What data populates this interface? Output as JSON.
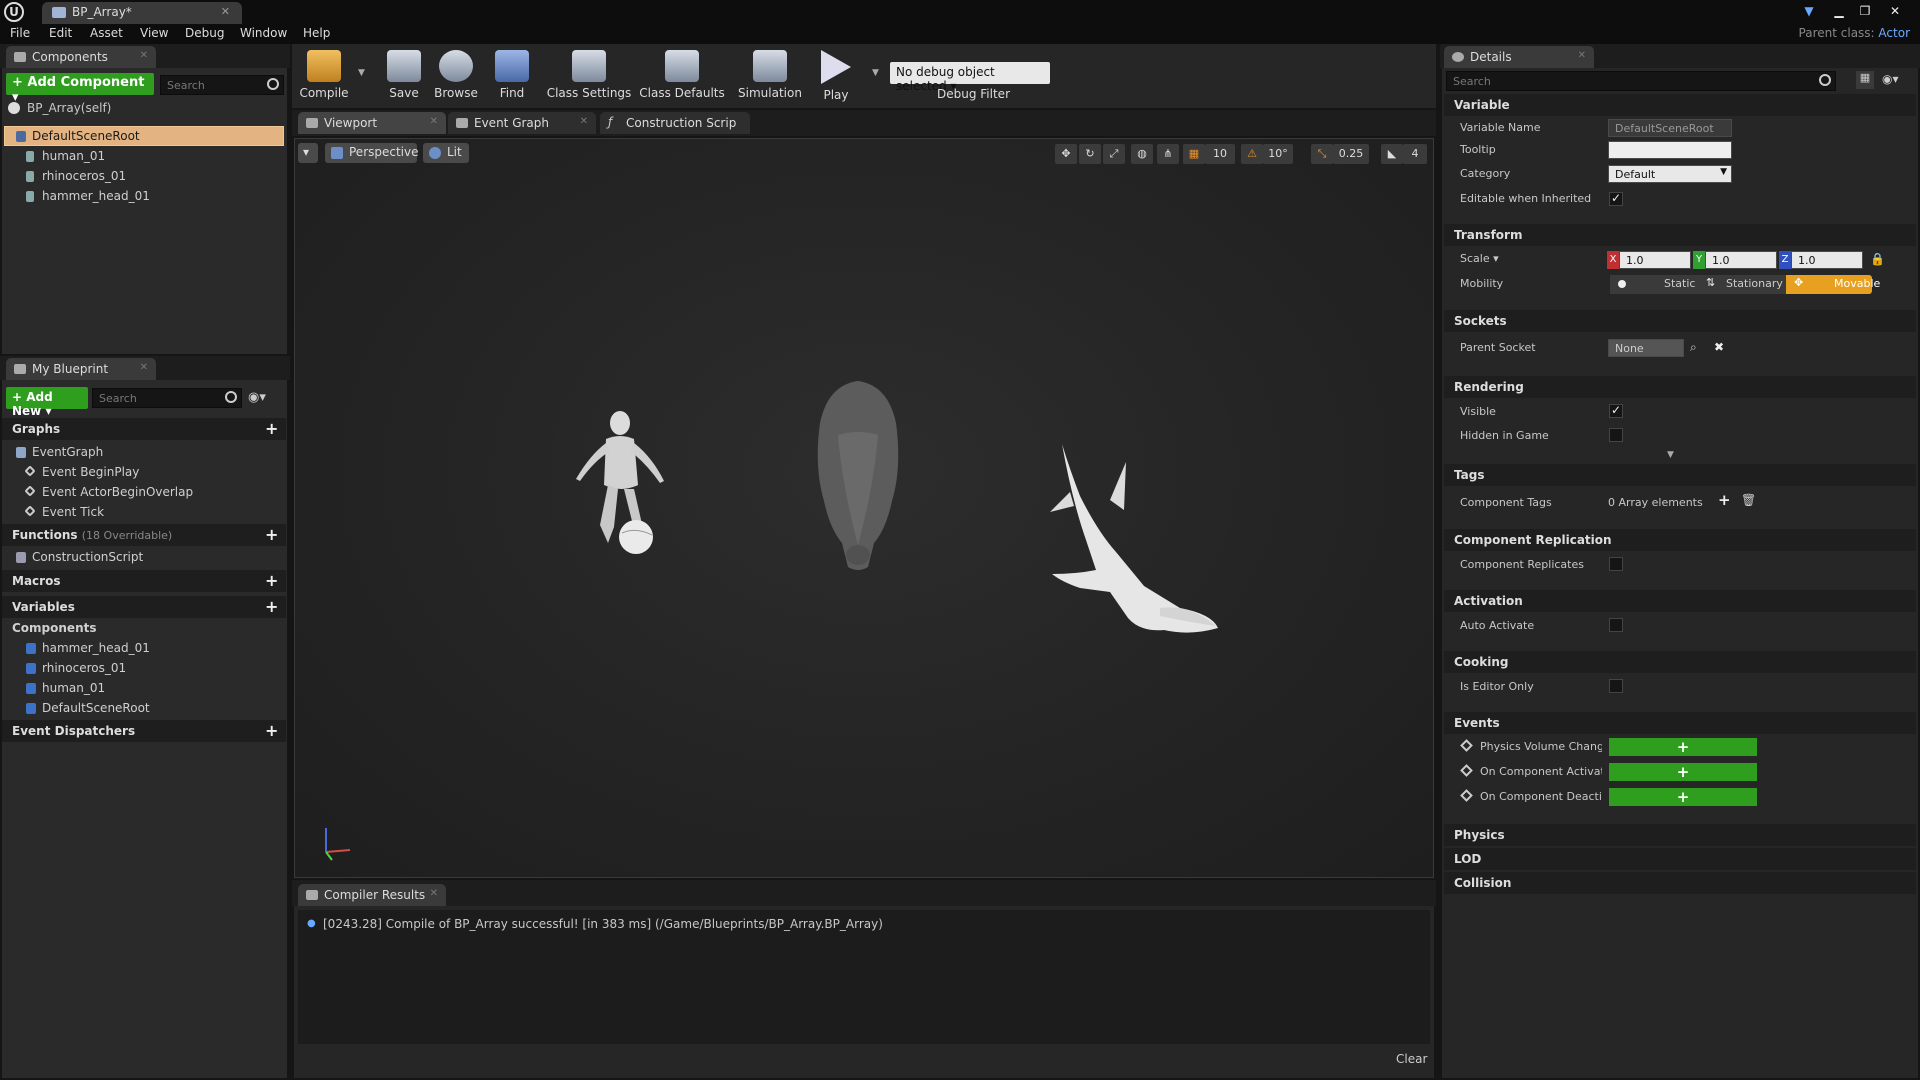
{
  "window": {
    "tab_title": "BP_Array*",
    "parent_class_label": "Parent class:",
    "parent_class_value": "Actor"
  },
  "menu": [
    "File",
    "Edit",
    "Asset",
    "View",
    "Debug",
    "Window",
    "Help"
  ],
  "components_panel": {
    "tab_label": "Components",
    "add_button": "+ Add Component ▾",
    "search_placeholder": "Search",
    "self_label": "BP_Array(self)",
    "tree": [
      "DefaultSceneRoot",
      "human_01",
      "rhinoceros_01",
      "hammer_head_01"
    ]
  },
  "my_blueprint": {
    "tab_label": "My Blueprint",
    "add_new": "+ Add New ▾",
    "search_placeholder": "Search",
    "graphs_header": "Graphs",
    "event_graph": "EventGraph",
    "events": [
      "Event BeginPlay",
      "Event ActorBeginOverlap",
      "Event Tick"
    ],
    "functions_header": "Functions",
    "functions_count": "(18 Overridable)",
    "construction_script": "ConstructionScript",
    "macros_header": "Macros",
    "variables_header": "Variables",
    "components_header": "Components",
    "component_vars": [
      "hammer_head_01",
      "rhinoceros_01",
      "human_01",
      "DefaultSceneRoot"
    ],
    "dispatchers_header": "Event Dispatchers"
  },
  "toolbar": {
    "compile": "Compile",
    "save": "Save",
    "browse": "Browse",
    "find": "Find",
    "class_settings": "Class Settings",
    "class_defaults": "Class Defaults",
    "simulation": "Simulation",
    "play": "Play",
    "debug_dropdown": "No debug object selected ▾",
    "debug_filter": "Debug Filter"
  },
  "editor_tabs": [
    "Viewport",
    "Event Graph",
    "Construction Scrip"
  ],
  "viewport": {
    "perspective": "Perspective",
    "lit": "Lit",
    "grid_snap": "10",
    "rotation_snap": "10°",
    "scale_snap": "0.25",
    "camera_speed": "4"
  },
  "compiler": {
    "tab_label": "Compiler Results",
    "message": "[0243.28] Compile of BP_Array successful! [in 383 ms] (/Game/Blueprints/BP_Array.BP_Array)",
    "clear": "Clear"
  },
  "details": {
    "tab_label": "Details",
    "search_placeholder": "Search",
    "variable": {
      "header": "Variable",
      "name_label": "Variable Name",
      "name_value": "DefaultSceneRoot",
      "tooltip_label": "Tooltip",
      "tooltip_value": "",
      "category_label": "Category",
      "category_value": "Default",
      "editable_label": "Editable when Inherited"
    },
    "transform": {
      "header": "Transform",
      "scale_label": "Scale ▾",
      "x": "1.0",
      "y": "1.0",
      "z": "1.0",
      "mobility_label": "Mobility",
      "static": "Static",
      "stationary": "Stationary",
      "movable": "Movable"
    },
    "sockets": {
      "header": "Sockets",
      "parent_label": "Parent Socket",
      "parent_value": "None"
    },
    "rendering": {
      "header": "Rendering",
      "visible_label": "Visible",
      "hidden_label": "Hidden in Game"
    },
    "tags": {
      "header": "Tags",
      "label": "Component Tags",
      "value": "0 Array elements"
    },
    "replication": {
      "header": "Component Replication",
      "label": "Component Replicates"
    },
    "activation": {
      "header": "Activation",
      "label": "Auto Activate"
    },
    "cooking": {
      "header": "Cooking",
      "label": "Is Editor Only"
    },
    "events": {
      "header": "Events",
      "items": [
        "Physics Volume Change",
        "On Component Activate",
        "On Component Deactiva"
      ],
      "add": "+"
    },
    "collapsed": [
      "Physics",
      "LOD",
      "Collision"
    ]
  }
}
